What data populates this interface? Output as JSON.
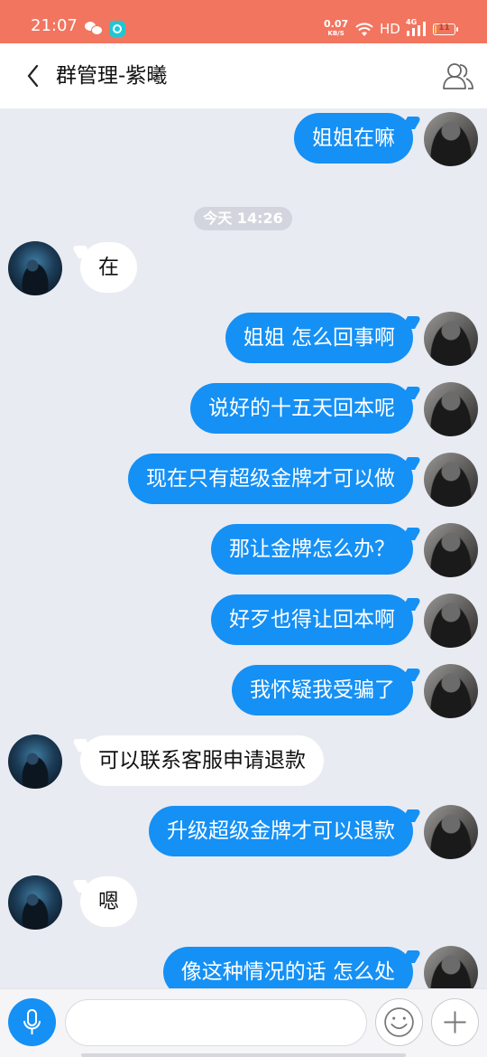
{
  "status_bar": {
    "time": "21:07",
    "net_speed": "0.07",
    "net_unit": "KB/S",
    "hd": "HD",
    "network": "4G",
    "battery": "11",
    "battery_level": 0.11,
    "icons": [
      "wechat-icon",
      "app-notification-icon",
      "wifi-icon",
      "signal-icon",
      "battery-icon"
    ]
  },
  "header": {
    "back_icon": "chevron-left-icon",
    "title": "群管理-紫曦",
    "group_icon": "group-members-icon"
  },
  "chat": {
    "timestamp": "今天 14:26",
    "messages": [
      {
        "sender": "me",
        "text": "姐姐在嘛"
      },
      {
        "sender": "other",
        "text": "在"
      },
      {
        "sender": "me",
        "text": "姐姐 怎么回事啊"
      },
      {
        "sender": "me",
        "text": "说好的十五天回本呢"
      },
      {
        "sender": "me",
        "text": "现在只有超级金牌才可以做"
      },
      {
        "sender": "me",
        "text": "那让金牌怎么办？"
      },
      {
        "sender": "me",
        "text": "好歹也得让回本啊"
      },
      {
        "sender": "me",
        "text": "我怀疑我受骗了"
      },
      {
        "sender": "other",
        "text": "可以联系客服申请退款"
      },
      {
        "sender": "me",
        "text": "升级超级金牌才可以退款"
      },
      {
        "sender": "other",
        "text": "嗯"
      },
      {
        "sender": "me",
        "text": "像这种情况的话  怎么处"
      }
    ]
  },
  "input_bar": {
    "mic_icon": "microphone-icon",
    "input_value": "",
    "input_placeholder": "",
    "emoji_icon": "smiley-icon",
    "plus_icon": "plus-icon"
  },
  "colors": {
    "status_bar": "#f2755f",
    "my_bubble": "#1590f5",
    "other_bubble": "#ffffff",
    "chat_background": "#e9ebf2"
  }
}
